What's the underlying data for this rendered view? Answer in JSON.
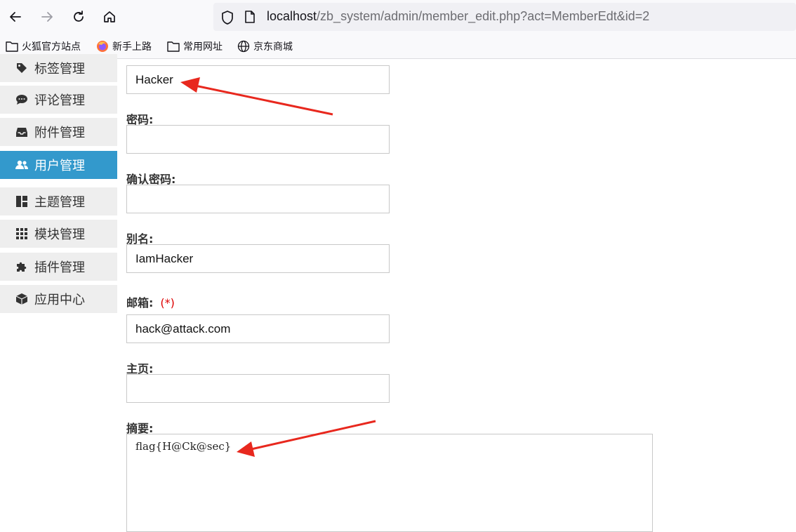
{
  "browser": {
    "url_host": "localhost",
    "url_path": "/zb_system/admin/member_edit.php?act=MemberEdt&id=2",
    "bookmarks": [
      {
        "label": "火狐官方站点",
        "icon": "folder-icon"
      },
      {
        "label": "新手上路",
        "icon": "firefox-icon"
      },
      {
        "label": "常用网址",
        "icon": "folder-icon"
      },
      {
        "label": "京东商城",
        "icon": "globe-icon"
      }
    ]
  },
  "sidebar": {
    "items": [
      {
        "label": "标签管理",
        "icon": "tag-icon"
      },
      {
        "label": "评论管理",
        "icon": "comment-icon"
      },
      {
        "label": "附件管理",
        "icon": "inbox-icon"
      },
      {
        "label": "用户管理",
        "icon": "users-icon",
        "active": true
      },
      {
        "label": "主题管理",
        "icon": "layout-icon"
      },
      {
        "label": "模块管理",
        "icon": "grid-icon"
      },
      {
        "label": "插件管理",
        "icon": "puzzle-icon"
      },
      {
        "label": "应用中心",
        "icon": "cube-icon"
      }
    ]
  },
  "form": {
    "username_value": "Hacker",
    "password_label": "密码:",
    "password_value": "",
    "confirm_label": "确认密码:",
    "confirm_value": "",
    "alias_label": "别名:",
    "alias_value": "IamHacker",
    "email_label": "邮箱:",
    "email_required": "(*)",
    "email_value": "hack@attack.com",
    "homepage_label": "主页:",
    "homepage_value": "",
    "intro_label": "摘要:",
    "intro_value": "flag{H@Ck@sec}"
  },
  "colors": {
    "active_sidebar": "#3399cc",
    "annotation_arrow": "#e8281e"
  }
}
